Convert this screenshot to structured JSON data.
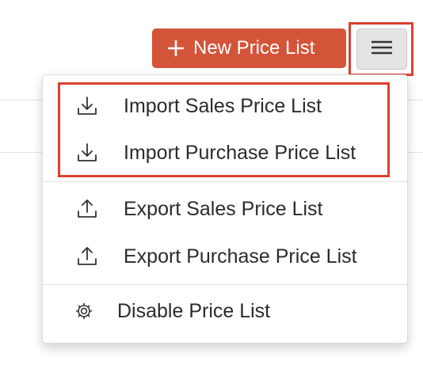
{
  "header": {
    "new_button_label": "New Price List"
  },
  "menu": {
    "items": [
      {
        "label": "Import Sales Price List",
        "icon": "download-icon"
      },
      {
        "label": "Import Purchase Price List",
        "icon": "download-icon"
      },
      {
        "label": "Export Sales Price List",
        "icon": "upload-icon"
      },
      {
        "label": "Export Purchase Price List",
        "icon": "upload-icon"
      },
      {
        "label": "Disable Price List",
        "icon": "gear-icon"
      }
    ]
  },
  "colors": {
    "accent": "#d4543a",
    "highlight": "#d9412f"
  }
}
